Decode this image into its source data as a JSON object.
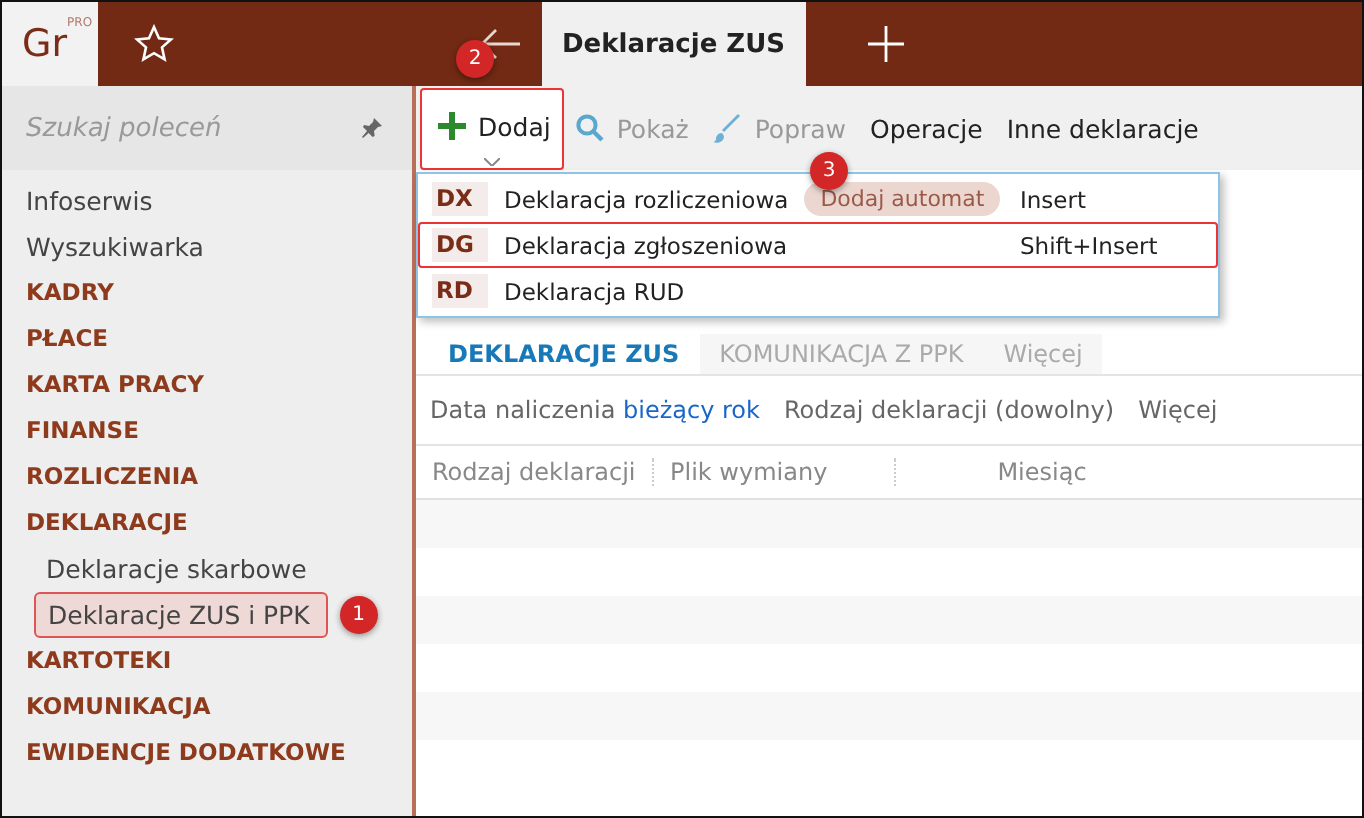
{
  "logo": {
    "text": "Gr",
    "superscript": "PRO"
  },
  "tabs": [
    {
      "label": "Deklaracje ZUS",
      "selected": true
    }
  ],
  "search": {
    "placeholder": "Szukaj poleceń"
  },
  "sidebar": {
    "items": [
      {
        "label": "Infoserwis",
        "kind": "link",
        "selected": false
      },
      {
        "label": "Wyszukiwarka",
        "kind": "link",
        "selected": false
      },
      {
        "label": "KADRY",
        "kind": "section",
        "selected": false
      },
      {
        "label": "PŁACE",
        "kind": "section",
        "selected": false
      },
      {
        "label": "KARTA PRACY",
        "kind": "section",
        "selected": false
      },
      {
        "label": "FINANSE",
        "kind": "section",
        "selected": false
      },
      {
        "label": "ROZLICZENIA",
        "kind": "section",
        "selected": false
      },
      {
        "label": "DEKLARACJE",
        "kind": "section",
        "selected": false,
        "children": [
          {
            "label": "Deklaracje skarbowe",
            "kind": "link",
            "selected": false
          },
          {
            "label": "Deklaracje ZUS i PPK",
            "kind": "link",
            "selected": true,
            "callout": "1"
          }
        ]
      },
      {
        "label": "KARTOTEKI",
        "kind": "section",
        "selected": false
      },
      {
        "label": "KOMUNIKACJA",
        "kind": "section",
        "selected": false
      },
      {
        "label": "EWIDENCJE DODATKOWE",
        "kind": "section",
        "selected": false
      }
    ]
  },
  "toolbar": [
    {
      "label": "Dodaj",
      "kind": "add",
      "disabled": false,
      "highlighted": true,
      "callout": "2"
    },
    {
      "label": "Pokaż",
      "kind": "view",
      "disabled": true,
      "highlighted": false
    },
    {
      "label": "Popraw",
      "kind": "edit",
      "disabled": true,
      "highlighted": false
    },
    {
      "label": "Operacje",
      "kind": "text",
      "disabled": false,
      "highlighted": false
    },
    {
      "label": "Inne deklaracje",
      "kind": "text",
      "disabled": false,
      "highlighted": false
    }
  ],
  "dropdown": [
    {
      "code": "DX",
      "label": "Deklaracja rozliczeniowa",
      "tag": "Dodaj automat",
      "shortcut": "Insert",
      "highlighted": false,
      "callout": "3"
    },
    {
      "code": "DG",
      "label": "Deklaracja zgłoszeniowa",
      "shortcut": "Shift+Insert",
      "highlighted": true
    },
    {
      "code": "RD",
      "label": "Deklaracja RUD",
      "highlighted": false
    }
  ],
  "view_tabs": [
    {
      "label": "DEKLARACJE ZUS",
      "selected": true
    },
    {
      "label": "KOMUNIKACJA Z PPK",
      "selected": false
    },
    {
      "label": "Więcej",
      "selected": false
    }
  ],
  "filters": [
    {
      "label": "Data naliczenia",
      "value": "bieżący rok"
    },
    {
      "label": "Rodzaj deklaracji (dowolny)"
    },
    {
      "label": "Więcej"
    }
  ],
  "table": {
    "columns": [
      "Rodzaj deklaracji",
      "Plik wymiany",
      "Miesiąc"
    ]
  }
}
